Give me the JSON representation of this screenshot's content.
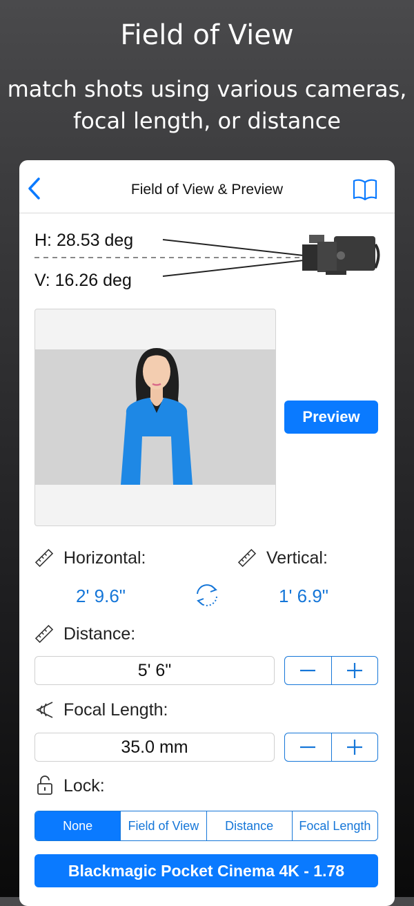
{
  "promo": {
    "title": "Field of View",
    "subtitle_line1": "match shots using various cameras,",
    "subtitle_line2": "focal length, or distance"
  },
  "nav": {
    "title": "Field of View & Preview",
    "back_icon": "chevron-left-icon",
    "book_icon": "book-icon"
  },
  "fov": {
    "h_text": "H:  28.53 deg",
    "v_text": "V:  16.26 deg"
  },
  "preview": {
    "button_label": "Preview"
  },
  "dimensions": {
    "horizontal_label": "Horizontal:",
    "horizontal_value": "2' 9.6\"",
    "vertical_label": "Vertical:",
    "vertical_value": "1' 6.9\""
  },
  "distance": {
    "label": "Distance:",
    "value": "5' 6\""
  },
  "focal": {
    "label": "Focal Length:",
    "value": "35.0 mm"
  },
  "lock": {
    "label": "Lock:",
    "options": [
      "None",
      "Field of View",
      "Distance",
      "Focal Length"
    ],
    "selected": "None"
  },
  "camera": {
    "label": "Blackmagic Pocket Cinema 4K - 1.78"
  },
  "colors": {
    "accent": "#0a7aff",
    "value_text": "#1576d8",
    "shirt": "#1e88e5"
  }
}
